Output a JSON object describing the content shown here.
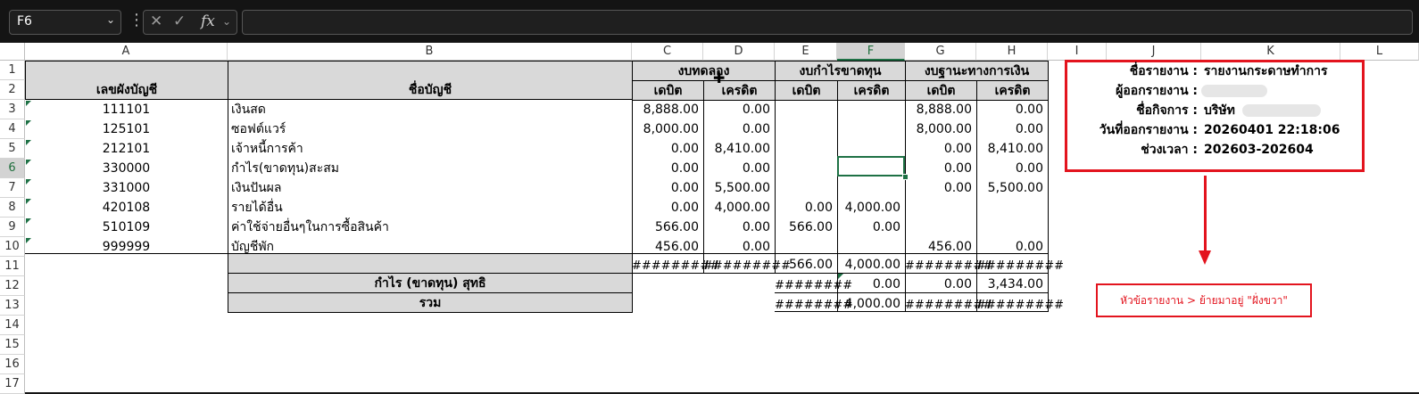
{
  "toolbar": {
    "name_box": "F6",
    "fx_label": "fx",
    "cancel_icon": "close-icon",
    "confirm_icon": "check-icon",
    "formula": ""
  },
  "columns": [
    "A",
    "B",
    "C",
    "D",
    "E",
    "F",
    "G",
    "H",
    "I",
    "J",
    "K",
    "L"
  ],
  "rows": [
    "1",
    "2",
    "3",
    "4",
    "5",
    "6",
    "7",
    "8",
    "9",
    "10",
    "11",
    "12",
    "13",
    "14",
    "15",
    "16",
    "17"
  ],
  "headers": {
    "account_no": "เลขผังบัญชี",
    "account_name": "ชื่อบัญชี",
    "trial_balance": "งบทดลอง",
    "profit_loss": "งบกำไรขาดทุน",
    "balance_sheet": "งบฐานะทางการเงิน",
    "debit": "เดบิต",
    "credit": "เครดิต"
  },
  "table": [
    {
      "no": "111101",
      "name": "เงินสด",
      "c": "8,888.00",
      "d": "0.00",
      "e": "",
      "f": "",
      "g": "8,888.00",
      "h": "0.00"
    },
    {
      "no": "125101",
      "name": "ซอฟต์แวร์",
      "c": "8,000.00",
      "d": "0.00",
      "e": "",
      "f": "",
      "g": "8,000.00",
      "h": "0.00"
    },
    {
      "no": "212101",
      "name": "เจ้าหนี้การค้า",
      "c": "0.00",
      "d": "8,410.00",
      "e": "",
      "f": "",
      "g": "0.00",
      "h": "8,410.00"
    },
    {
      "no": "330000",
      "name": "กำไร(ขาดทุน)สะสม",
      "c": "0.00",
      "d": "0.00",
      "e": "",
      "f": "",
      "g": "0.00",
      "h": "0.00"
    },
    {
      "no": "331000",
      "name": "เงินปันผล",
      "c": "0.00",
      "d": "5,500.00",
      "e": "",
      "f": "",
      "g": "0.00",
      "h": "5,500.00"
    },
    {
      "no": "420108",
      "name": "รายได้อื่น",
      "c": "0.00",
      "d": "4,000.00",
      "e": "0.00",
      "f": "4,000.00",
      "g": "",
      "h": ""
    },
    {
      "no": "510109",
      "name": "ค่าใช้จ่ายอื่นๆในการซื้อสินค้า",
      "c": "566.00",
      "d": "0.00",
      "e": "566.00",
      "f": "0.00",
      "g": "",
      "h": ""
    },
    {
      "no": "999999",
      "name": "บัญชีพัก",
      "c": "456.00",
      "d": "0.00",
      "e": "",
      "f": "",
      "g": "456.00",
      "h": "0.00"
    }
  ],
  "totals": {
    "c": "#########",
    "d": "#########",
    "e": "566.00",
    "f": "4,000.00",
    "g": "#########",
    "h": "#########"
  },
  "net_profit": {
    "label": "กำไร (ขาดทุน) สุทธิ",
    "e": "########",
    "f": "0.00",
    "g": "0.00",
    "h": "3,434.00"
  },
  "grand_total": {
    "label": "รวม",
    "e": "########",
    "f": "4,000.00",
    "g": "#########",
    "h": "#########"
  },
  "report_info": {
    "report_name_label": "ชื่อรายงาน :",
    "report_name": "รายงานกระดาษทำการ",
    "issuer_label": "ผู้ออกรายงาน :",
    "company_label": "ชื่อกิจการ :",
    "company": "บริษัท",
    "issue_date_label": "วันที่ออกรายงาน :",
    "issue_date": "20260401 22:18:06",
    "period_label": "ช่วงเวลา :",
    "period": "202603-202604"
  },
  "annotation": "หัวข้อรายงาน > ย้ายมาอยู่ \"ฝั่งขวา\"",
  "colors": {
    "highlight": "#e3141e",
    "selection": "#1e7145",
    "header_fill": "#d9d9d9"
  }
}
